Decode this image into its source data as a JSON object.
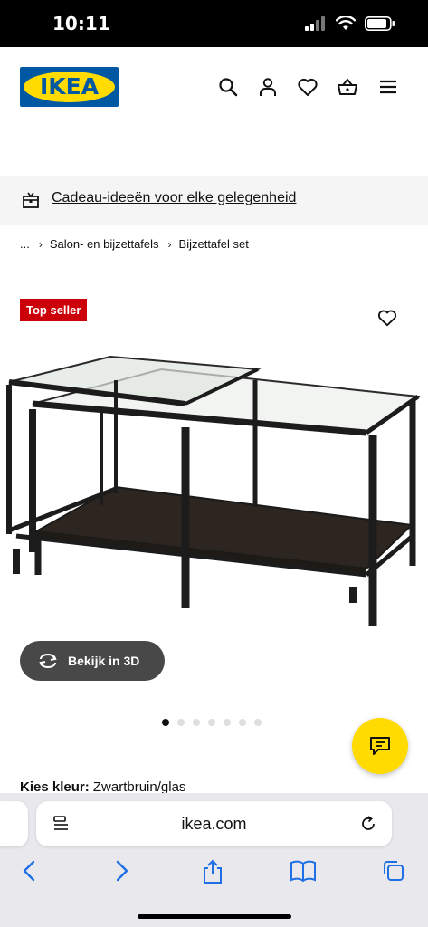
{
  "status_bar": {
    "time": "10:11",
    "battery_icon": "battery-icon",
    "wifi_icon": "wifi-icon",
    "signal_icon": "signal-icon"
  },
  "header": {
    "logo_text": "IKEA",
    "colors": {
      "brand_blue": "#0058a3",
      "brand_yellow": "#ffdb00"
    },
    "icons": [
      "search-icon",
      "account-icon",
      "heart-icon",
      "basket-icon",
      "menu-icon"
    ]
  },
  "banner": {
    "text": "Cadeau-ideeën voor elke gelegenheid",
    "icon": "gift-box-icon"
  },
  "breadcrumb": {
    "items": [
      "...",
      "Salon- en bijzettafels",
      "Bijzettafel set"
    ]
  },
  "product": {
    "badge": "Top seller",
    "badge_color": "#cc0008",
    "view_3d_label": "Bekijk in 3D",
    "carousel_total": 7,
    "carousel_active": 1,
    "color_label": "Kies kleur:",
    "color_value": "Zwartbruin/glas"
  },
  "browser": {
    "url": "ikea.com",
    "icons": [
      "back-icon",
      "forward-icon",
      "share-icon",
      "bookmarks-icon",
      "tabs-icon"
    ]
  }
}
